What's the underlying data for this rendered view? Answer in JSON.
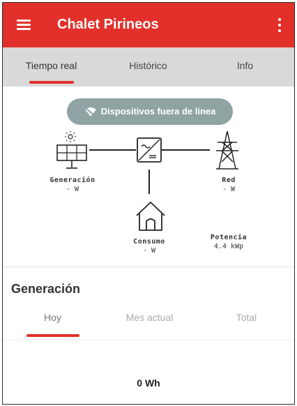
{
  "appbar": {
    "title": "Chalet Pirineos",
    "menu_icon": "menu-icon",
    "more_icon": "more-vert-icon",
    "color": "#e3302a"
  },
  "tabs": [
    {
      "label": "Tiempo real",
      "active": true
    },
    {
      "label": "Histórico",
      "active": false
    },
    {
      "label": "Info",
      "active": false
    }
  ],
  "status_pill": {
    "icon": "wifi-off-icon",
    "label": "Dispositivos fuera de línea"
  },
  "flow": {
    "generation": {
      "label": "Generación",
      "value": "- W",
      "icon": "solar-panel-icon"
    },
    "grid": {
      "label": "Red",
      "value": "- W",
      "icon": "power-tower-icon"
    },
    "consumption": {
      "label": "Consumo",
      "value": "- W",
      "icon": "house-icon"
    },
    "inverter_icon": "inverter-icon",
    "power": {
      "label": "Potencia",
      "value": "4.4 kWp"
    }
  },
  "generation_section": {
    "title": "Generación",
    "tabs": [
      {
        "label": "Hoy",
        "active": true
      },
      {
        "label": "Mes actual",
        "active": false
      },
      {
        "label": "Total",
        "active": false
      }
    ],
    "value": "0 Wh"
  }
}
